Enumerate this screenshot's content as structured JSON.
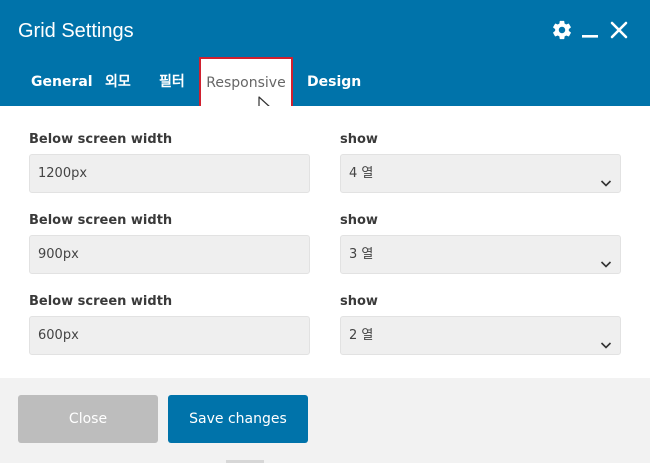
{
  "dialog": {
    "title": "Grid Settings",
    "header_icons": [
      "gear-icon",
      "minimize-icon",
      "close-icon"
    ],
    "accent_color": "#0073aa"
  },
  "tabs": [
    {
      "label": "General",
      "active": false
    },
    {
      "label": "외모",
      "active": false
    },
    {
      "label": "필터",
      "active": false
    },
    {
      "label": "Responsive",
      "active": true
    },
    {
      "label": "Design",
      "active": false
    }
  ],
  "rows": [
    {
      "width_label": "Below screen width",
      "width_value": "1200px",
      "show_label": "show",
      "show_value": "4 열"
    },
    {
      "width_label": "Below screen width",
      "width_value": "900px",
      "show_label": "show",
      "show_value": "3 열"
    },
    {
      "width_label": "Below screen width",
      "width_value": "600px",
      "show_label": "show",
      "show_value": "2 열"
    }
  ],
  "footer": {
    "close_label": "Close",
    "save_label": "Save changes"
  }
}
